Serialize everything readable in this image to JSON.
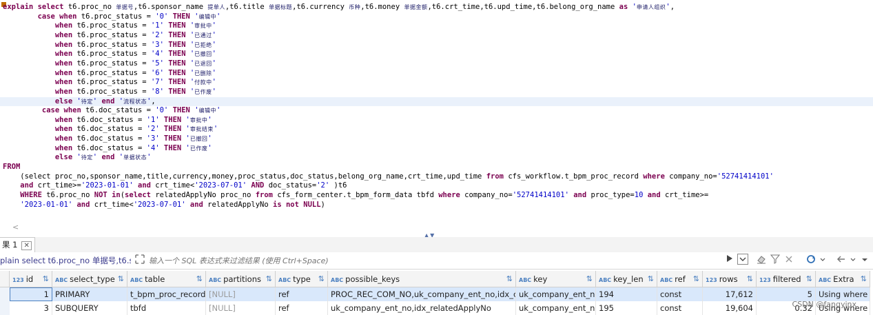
{
  "editor": {
    "lines": [
      [
        [
          "kw",
          "explain select "
        ],
        [
          "txt",
          "t6.proc_no "
        ],
        [
          "cjk",
          "单据号"
        ],
        [
          "txt",
          ",t6.sponsor_name "
        ],
        [
          "cjk",
          "提单人"
        ],
        [
          "txt",
          ",t6.title "
        ],
        [
          "cjk",
          "单据标题"
        ],
        [
          "txt",
          ",t6.currency "
        ],
        [
          "cjk",
          "币种"
        ],
        [
          "txt",
          ",t6.money "
        ],
        [
          "cjk",
          "单据金额"
        ],
        [
          "txt",
          ",t6.crt_time,t6.upd_time,t6.belong_org_name "
        ],
        [
          "kw",
          "as "
        ],
        [
          "str",
          "'"
        ],
        [
          "cjk",
          "申请人组织"
        ],
        [
          "str",
          "'"
        ],
        [
          "txt",
          ","
        ]
      ],
      [
        [
          "txt",
          "        "
        ],
        [
          "kw",
          "case when "
        ],
        [
          "txt",
          "t6.proc_status = "
        ],
        [
          "str",
          "'0' "
        ],
        [
          "kw",
          "THEN "
        ],
        [
          "str",
          "'"
        ],
        [
          "cjk",
          "编辑中"
        ],
        [
          "str",
          "'"
        ]
      ],
      [
        [
          "txt",
          "            "
        ],
        [
          "kw",
          "when "
        ],
        [
          "txt",
          "t6.proc_status = "
        ],
        [
          "str",
          "'1' "
        ],
        [
          "kw",
          "THEN "
        ],
        [
          "str",
          "'"
        ],
        [
          "cjk",
          "审批中"
        ],
        [
          "str",
          "'"
        ]
      ],
      [
        [
          "txt",
          "            "
        ],
        [
          "kw",
          "when "
        ],
        [
          "txt",
          "t6.proc_status = "
        ],
        [
          "str",
          "'2' "
        ],
        [
          "kw",
          "THEN "
        ],
        [
          "str",
          "'"
        ],
        [
          "cjk",
          "已通过"
        ],
        [
          "str",
          "'"
        ]
      ],
      [
        [
          "txt",
          "            "
        ],
        [
          "kw",
          "when "
        ],
        [
          "txt",
          "t6.proc_status = "
        ],
        [
          "str",
          "'3' "
        ],
        [
          "kw",
          "THEN "
        ],
        [
          "str",
          "'"
        ],
        [
          "cjk",
          "已拒绝"
        ],
        [
          "str",
          "'"
        ]
      ],
      [
        [
          "txt",
          "            "
        ],
        [
          "kw",
          "when "
        ],
        [
          "txt",
          "t6.proc_status = "
        ],
        [
          "str",
          "'4' "
        ],
        [
          "kw",
          "THEN "
        ],
        [
          "str",
          "'"
        ],
        [
          "cjk",
          "已撤回"
        ],
        [
          "str",
          "'"
        ]
      ],
      [
        [
          "txt",
          "            "
        ],
        [
          "kw",
          "when "
        ],
        [
          "txt",
          "t6.proc_status = "
        ],
        [
          "str",
          "'5' "
        ],
        [
          "kw",
          "THEN "
        ],
        [
          "str",
          "'"
        ],
        [
          "cjk",
          "已退回"
        ],
        [
          "str",
          "'"
        ]
      ],
      [
        [
          "txt",
          "            "
        ],
        [
          "kw",
          "when "
        ],
        [
          "txt",
          "t6.proc_status = "
        ],
        [
          "str",
          "'6' "
        ],
        [
          "kw",
          "THEN "
        ],
        [
          "str",
          "'"
        ],
        [
          "cjk",
          "已删除"
        ],
        [
          "str",
          "'"
        ]
      ],
      [
        [
          "txt",
          "            "
        ],
        [
          "kw",
          "when "
        ],
        [
          "txt",
          "t6.proc_status = "
        ],
        [
          "str",
          "'7' "
        ],
        [
          "kw",
          "THEN "
        ],
        [
          "str",
          "'"
        ],
        [
          "cjk",
          "付款中"
        ],
        [
          "str",
          "'"
        ]
      ],
      [
        [
          "txt",
          "            "
        ],
        [
          "kw",
          "when "
        ],
        [
          "txt",
          "t6.proc_status = "
        ],
        [
          "str",
          "'8' "
        ],
        [
          "kw",
          "THEN "
        ],
        [
          "str",
          "'"
        ],
        [
          "cjk",
          "已作废"
        ],
        [
          "str",
          "'"
        ]
      ],
      [
        [
          "txt",
          "            "
        ],
        [
          "kw",
          "else "
        ],
        [
          "str",
          "'"
        ],
        [
          "cjk",
          "待定"
        ],
        [
          "str",
          "' "
        ],
        [
          "kw",
          "end "
        ],
        [
          "str",
          "'"
        ],
        [
          "cjk",
          "流程状态"
        ],
        [
          "str",
          "'"
        ],
        [
          "txt",
          ","
        ]
      ],
      [
        [
          "txt",
          "         "
        ],
        [
          "kw",
          "case when "
        ],
        [
          "txt",
          "t6.doc_status = "
        ],
        [
          "str",
          "'0' "
        ],
        [
          "kw",
          "THEN "
        ],
        [
          "str",
          "'"
        ],
        [
          "cjk",
          "编辑中"
        ],
        [
          "str",
          "'"
        ]
      ],
      [
        [
          "txt",
          "            "
        ],
        [
          "kw",
          "when "
        ],
        [
          "txt",
          "t6.doc_status = "
        ],
        [
          "str",
          "'1' "
        ],
        [
          "kw",
          "THEN "
        ],
        [
          "str",
          "'"
        ],
        [
          "cjk",
          "审批中"
        ],
        [
          "str",
          "'"
        ]
      ],
      [
        [
          "txt",
          "            "
        ],
        [
          "kw",
          "when "
        ],
        [
          "txt",
          "t6.doc_status = "
        ],
        [
          "str",
          "'2' "
        ],
        [
          "kw",
          "THEN "
        ],
        [
          "str",
          "'"
        ],
        [
          "cjk",
          "审批结束"
        ],
        [
          "str",
          "'"
        ]
      ],
      [
        [
          "txt",
          "            "
        ],
        [
          "kw",
          "when "
        ],
        [
          "txt",
          "t6.doc_status = "
        ],
        [
          "str",
          "'3' "
        ],
        [
          "kw",
          "THEN "
        ],
        [
          "str",
          "'"
        ],
        [
          "cjk",
          "已撤回"
        ],
        [
          "str",
          "'"
        ]
      ],
      [
        [
          "txt",
          "            "
        ],
        [
          "kw",
          "when "
        ],
        [
          "txt",
          "t6.doc_status = "
        ],
        [
          "str",
          "'4' "
        ],
        [
          "kw",
          "THEN "
        ],
        [
          "str",
          "'"
        ],
        [
          "cjk",
          "已作废"
        ],
        [
          "str",
          "'"
        ]
      ],
      [
        [
          "txt",
          "            "
        ],
        [
          "kw",
          "else "
        ],
        [
          "str",
          "'"
        ],
        [
          "cjk",
          "待定"
        ],
        [
          "str",
          "' "
        ],
        [
          "kw",
          "end "
        ],
        [
          "str",
          "'"
        ],
        [
          "cjk",
          "单据状态"
        ],
        [
          "str",
          "'"
        ]
      ],
      [
        [
          "kw",
          "FROM"
        ]
      ],
      [
        [
          "txt",
          "    (select proc_no,sponsor_name,title,currency,money,proc_status,doc_status,belong_org_name,crt_time,upd_time "
        ],
        [
          "kw",
          "from "
        ],
        [
          "txt",
          "cfs_workflow.t_bpm_proc_record "
        ],
        [
          "kw",
          "where "
        ],
        [
          "txt",
          "company_no="
        ],
        [
          "str",
          "'52741414101'"
        ]
      ],
      [
        [
          "txt",
          "    "
        ],
        [
          "kw",
          "and "
        ],
        [
          "txt",
          "crt_time>="
        ],
        [
          "str",
          "'2023-01-01' "
        ],
        [
          "kw",
          "and "
        ],
        [
          "txt",
          "crt_time<"
        ],
        [
          "str",
          "'2023-07-01' "
        ],
        [
          "kw",
          "AND "
        ],
        [
          "txt",
          "doc_status="
        ],
        [
          "str",
          "'2' "
        ],
        [
          "txt",
          ")t6"
        ]
      ],
      [
        [
          "txt",
          "    "
        ],
        [
          "kw",
          "WHERE "
        ],
        [
          "txt",
          "t6.proc_no "
        ],
        [
          "kw",
          "NOT in"
        ],
        [
          "txt",
          "("
        ],
        [
          "kw",
          "select "
        ],
        [
          "txt",
          "relatedApplyNo proc_no "
        ],
        [
          "kw",
          "from "
        ],
        [
          "txt",
          "cfs_form_center.t_bpm_form_data tbfd "
        ],
        [
          "kw",
          "where "
        ],
        [
          "txt",
          "company_no="
        ],
        [
          "str",
          "'52741414101' "
        ],
        [
          "kw",
          "and "
        ],
        [
          "txt",
          "proc_type="
        ],
        [
          "str",
          "10 "
        ],
        [
          "kw",
          "and "
        ],
        [
          "txt",
          "crt_time>="
        ]
      ],
      [
        [
          "txt",
          "    "
        ],
        [
          "str",
          "'2023-01-01' "
        ],
        [
          "kw",
          "and "
        ],
        [
          "txt",
          "crt_time<"
        ],
        [
          "str",
          "'2023-07-01' "
        ],
        [
          "kw",
          "and "
        ],
        [
          "txt",
          "relatedApplyNo "
        ],
        [
          "kw",
          "is not NULL"
        ],
        [
          "txt",
          ")"
        ]
      ]
    ],
    "hscroll_left_arrow": "<",
    "split_handle": "▲▼"
  },
  "result_tab": {
    "label": "果 1",
    "close_glyph": "✕"
  },
  "filterbar": {
    "query_label": "plain select t6.proc_no 单据号,t6.spo",
    "placeholder": "输入一个 SQL 表达式来过滤结果 (使用 Ctrl+Space)"
  },
  "grid": {
    "columns": [
      {
        "label": "id",
        "type": "123"
      },
      {
        "label": "select_type",
        "type": "ABC"
      },
      {
        "label": "table",
        "type": "ABC"
      },
      {
        "label": "partitions",
        "type": "ABC"
      },
      {
        "label": "type",
        "type": "ABC"
      },
      {
        "label": "possible_keys",
        "type": "ABC"
      },
      {
        "label": "key",
        "type": "ABC"
      },
      {
        "label": "key_len",
        "type": "ABC"
      },
      {
        "label": "ref",
        "type": "ABC"
      },
      {
        "label": "rows",
        "type": "123"
      },
      {
        "label": "filtered",
        "type": "123"
      },
      {
        "label": "Extra",
        "type": "ABC"
      }
    ],
    "rows": [
      [
        "1",
        "PRIMARY",
        "t_bpm_proc_record",
        "[NULL]",
        "ref",
        "PROC_REC_COM_NO,uk_company_ent_no,idx_crt_time",
        "uk_company_ent_no",
        "194",
        "const",
        "17,612",
        "5",
        "Using where"
      ],
      [
        "3",
        "SUBQUERY",
        "tbfd",
        "[NULL]",
        "ref",
        "uk_company_ent_no,idx_relatedApplyNo",
        "uk_company_ent_no",
        "195",
        "const",
        "19,604",
        "0.32",
        "Using where"
      ]
    ]
  },
  "watermark": "CSDN @fangyinx"
}
